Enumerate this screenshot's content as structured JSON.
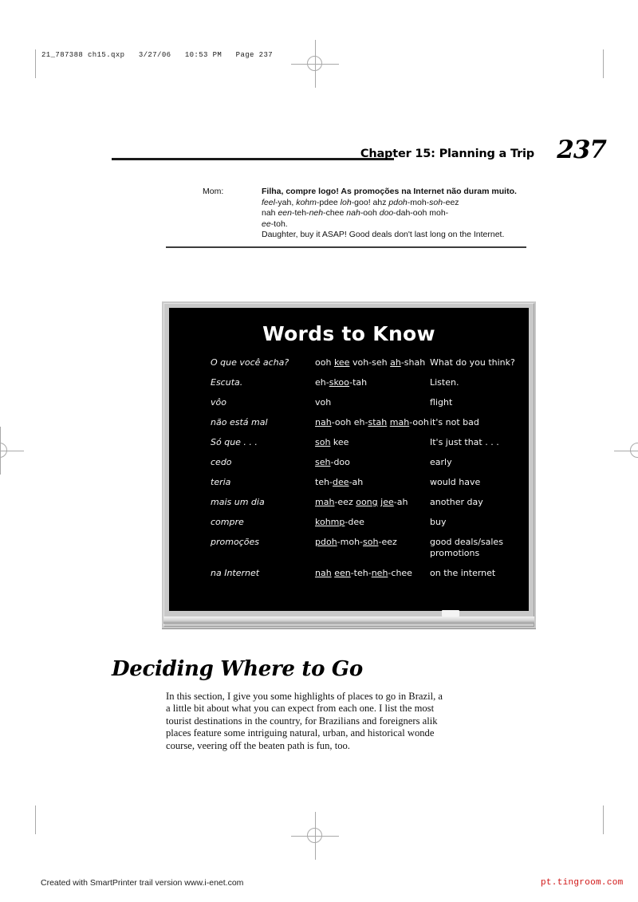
{
  "slug": {
    "text": "21_787388 ch15.qxp   3/27/06   10:53 PM   Page 237"
  },
  "running_head": {
    "chapter_title": "Chapter 15: Planning a Trip",
    "page_number": "237"
  },
  "dialogue": {
    "speaker": "Mom:",
    "portuguese": "Filha, compre logo! As promoções na Internet não duram muito.",
    "pronunciation_line1_a": "feel",
    "pronunciation_line1_b": "-yah, ",
    "pronunciation_line1_c": "kohm",
    "pronunciation_line1_d": "-pdee ",
    "pronunciation_line1_e": "loh",
    "pronunciation_line1_f": "-goo! ahz ",
    "pronunciation_line1_g": "pdoh",
    "pronunciation_line1_h": "-moh-",
    "pronunciation_line1_i": "soh",
    "pronunciation_line1_j": "-eez",
    "pronunciation_line2_a": "nah ",
    "pronunciation_line2_b": "een",
    "pronunciation_line2_c": "-teh-",
    "pronunciation_line2_d": "neh",
    "pronunciation_line2_e": "-chee ",
    "pronunciation_line2_f": "nah",
    "pronunciation_line2_g": "-ooh ",
    "pronunciation_line2_h": "doo",
    "pronunciation_line2_i": "-dah-ooh moh-",
    "pronunciation_line3_a": "ee",
    "pronunciation_line3_b": "-toh.",
    "translation": "Daughter, buy it ASAP! Good deals don't last long on the Internet."
  },
  "blackboard": {
    "title": "Words to Know",
    "rows": [
      {
        "term": "O que você acha?",
        "pron_parts": [
          {
            "text": "ooh ",
            "stress": false
          },
          {
            "text": "kee",
            "stress": true
          },
          {
            "text": " voh-seh ",
            "stress": false
          },
          {
            "text": "ah",
            "stress": true
          },
          {
            "text": "-shah",
            "stress": false
          }
        ],
        "pron_plain": "ooh kee voh-seh ah-shah",
        "meaning": "What do you think?",
        "gap_before": false
      },
      {
        "term": "Escuta.",
        "pron_parts": [
          {
            "text": "eh-",
            "stress": false
          },
          {
            "text": "skoo",
            "stress": true
          },
          {
            "text": "-tah",
            "stress": false
          }
        ],
        "pron_plain": "eh-skoo-tah",
        "meaning": "Listen.",
        "gap_before": false
      },
      {
        "term": "vôo",
        "pron_parts": [
          {
            "text": "voh",
            "stress": false
          }
        ],
        "pron_plain": "voh",
        "meaning": "flight",
        "gap_before": false
      },
      {
        "term": "não está mal",
        "pron_parts": [
          {
            "text": "nah",
            "stress": true
          },
          {
            "text": "-ooh eh-",
            "stress": false
          },
          {
            "text": "stah",
            "stress": true
          },
          {
            "text": " ",
            "stress": false
          },
          {
            "text": "mah",
            "stress": true
          },
          {
            "text": "-ooh",
            "stress": false
          }
        ],
        "pron_plain": "nah-ooh eh-stah mah-ooh",
        "meaning": "it's not bad",
        "gap_before": false
      },
      {
        "term": "Só que . . .",
        "pron_parts": [
          {
            "text": "soh",
            "stress": true
          },
          {
            "text": " kee",
            "stress": false
          }
        ],
        "pron_plain": "soh kee",
        "meaning": "It's just that . . .",
        "gap_before": true
      },
      {
        "term": "cedo",
        "pron_parts": [
          {
            "text": "seh",
            "stress": true
          },
          {
            "text": "-doo",
            "stress": false
          }
        ],
        "pron_plain": "seh-doo",
        "meaning": "early",
        "gap_before": false
      },
      {
        "term": "teria",
        "pron_parts": [
          {
            "text": "teh-",
            "stress": false
          },
          {
            "text": "dee",
            "stress": true
          },
          {
            "text": "-ah",
            "stress": false
          }
        ],
        "pron_plain": "teh-dee-ah",
        "meaning": "would have",
        "gap_before": false
      },
      {
        "term": "mais um dia",
        "pron_parts": [
          {
            "text": "mah",
            "stress": true
          },
          {
            "text": "-eez ",
            "stress": false
          },
          {
            "text": "oong",
            "stress": true
          },
          {
            "text": " ",
            "stress": false
          },
          {
            "text": "jee",
            "stress": true
          },
          {
            "text": "-ah",
            "stress": false
          }
        ],
        "pron_plain": "mah-eez oong jee-ah",
        "meaning": "another day",
        "gap_before": false
      },
      {
        "term": "compre",
        "pron_parts": [
          {
            "text": "kohmp",
            "stress": true
          },
          {
            "text": "-dee",
            "stress": false
          }
        ],
        "pron_plain": "kohmp-dee",
        "meaning": "buy",
        "gap_before": false
      },
      {
        "term": "promoções",
        "pron_parts": [
          {
            "text": "pdoh",
            "stress": true
          },
          {
            "text": "-moh-",
            "stress": false
          },
          {
            "text": "soh",
            "stress": true
          },
          {
            "text": "-eez",
            "stress": false
          }
        ],
        "pron_plain": "pdoh-moh-soh-eez",
        "meaning": "good deals/sales promotions",
        "gap_before": false
      },
      {
        "term": "na Internet",
        "pron_parts": [
          {
            "text": "nah",
            "stress": true
          },
          {
            "text": " ",
            "stress": false
          },
          {
            "text": "een",
            "stress": true
          },
          {
            "text": "-teh-",
            "stress": false
          },
          {
            "text": "neh",
            "stress": true
          },
          {
            "text": "-chee",
            "stress": false
          }
        ],
        "pron_plain": "nah een-teh-neh-chee",
        "meaning": "on the internet",
        "gap_before": true
      }
    ]
  },
  "section": {
    "heading": "Deciding Where to Go",
    "paragraph_lines": [
      "In this section, I give you some highlights of places to go in Brazil, a",
      "a little bit about what you can expect from each one. I list the most",
      "tourist destinations in the country, for Brazilians and foreigners alik",
      "places feature some intriguing natural, urban, and historical wonde",
      "course, veering off the beaten path is fun, too."
    ]
  },
  "footer": {
    "credit": "Created with SmartPrinter trail version www.i-enet.com",
    "watermark": "pt.tingroom.com"
  }
}
